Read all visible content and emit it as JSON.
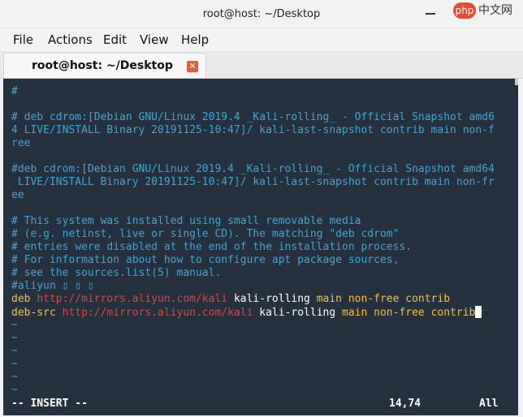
{
  "window": {
    "title": "root@host: ~/Desktop",
    "watermark_logo": "php",
    "watermark_text": "中文网"
  },
  "menu": [
    "File",
    "Actions",
    "Edit",
    "View",
    "Help"
  ],
  "tab": {
    "label": "root@host: ~/Desktop",
    "close_glyph": "✕"
  },
  "editor": {
    "lines": [
      {
        "parts": [
          {
            "t": "#",
            "c": "comment"
          }
        ]
      },
      {
        "parts": []
      },
      {
        "parts": [
          {
            "t": "# deb cdrom:[Debian GNU/Linux 2019.4 _Kali-rolling_ - Official Snapshot amd6",
            "c": "comment"
          }
        ]
      },
      {
        "parts": [
          {
            "t": "4 LIVE/INSTALL Binary 20191125-10:47]/ kali-last-snapshot contrib main non-f",
            "c": "comment"
          }
        ]
      },
      {
        "parts": [
          {
            "t": "ree",
            "c": "comment"
          }
        ]
      },
      {
        "parts": []
      },
      {
        "parts": [
          {
            "t": "#deb cdrom:[Debian GNU/Linux 2019.4 _Kali-rolling_ - Official Snapshot amd64",
            "c": "comment"
          }
        ]
      },
      {
        "parts": [
          {
            "t": " LIVE/INSTALL Binary 20191125-10:47]/ kali-last-snapshot contrib main non-fr",
            "c": "comment"
          }
        ]
      },
      {
        "parts": [
          {
            "t": "ee",
            "c": "comment"
          }
        ]
      },
      {
        "parts": []
      },
      {
        "parts": [
          {
            "t": "# This system was installed using small removable media",
            "c": "comment"
          }
        ]
      },
      {
        "parts": [
          {
            "t": "# (e.g. netinst, live or single CD). The matching \"deb cdrom\"",
            "c": "comment"
          }
        ]
      },
      {
        "parts": [
          {
            "t": "# entries were disabled at the end of the installation process.",
            "c": "comment"
          }
        ]
      },
      {
        "parts": [
          {
            "t": "# For information about how to configure apt package sources,",
            "c": "comment"
          }
        ]
      },
      {
        "parts": [
          {
            "t": "# see the sources.list(5) manual.",
            "c": "comment"
          }
        ]
      },
      {
        "parts": [
          {
            "t": "#aliyun ▯ ▯ ▯",
            "c": "comment"
          }
        ]
      },
      {
        "parts": [
          {
            "t": "deb ",
            "c": "kw"
          },
          {
            "t": "http://mirrors.aliyun.com/kali",
            "c": "url"
          },
          {
            "t": " kali-rolling ",
            "c": "white"
          },
          {
            "t": "main non-free contrib",
            "c": "kw"
          }
        ]
      },
      {
        "parts": [
          {
            "t": "deb-src ",
            "c": "kw"
          },
          {
            "t": "http://mirrors.aliyun.com/kali",
            "c": "url"
          },
          {
            "t": " kali-rolling ",
            "c": "white"
          },
          {
            "t": "main non-free contrib",
            "c": "kw"
          }
        ],
        "cursor": true
      },
      {
        "parts": [
          {
            "t": "~",
            "c": "tilde"
          }
        ]
      },
      {
        "parts": [
          {
            "t": "~",
            "c": "tilde"
          }
        ]
      },
      {
        "parts": [
          {
            "t": "~",
            "c": "tilde"
          }
        ]
      },
      {
        "parts": [
          {
            "t": "~",
            "c": "tilde"
          }
        ]
      },
      {
        "parts": [
          {
            "t": "~",
            "c": "tilde"
          }
        ]
      },
      {
        "parts": [
          {
            "t": "~",
            "c": "tilde"
          }
        ]
      }
    ],
    "mode": "-- INSERT --",
    "position": "14,74",
    "scroll": "All"
  }
}
